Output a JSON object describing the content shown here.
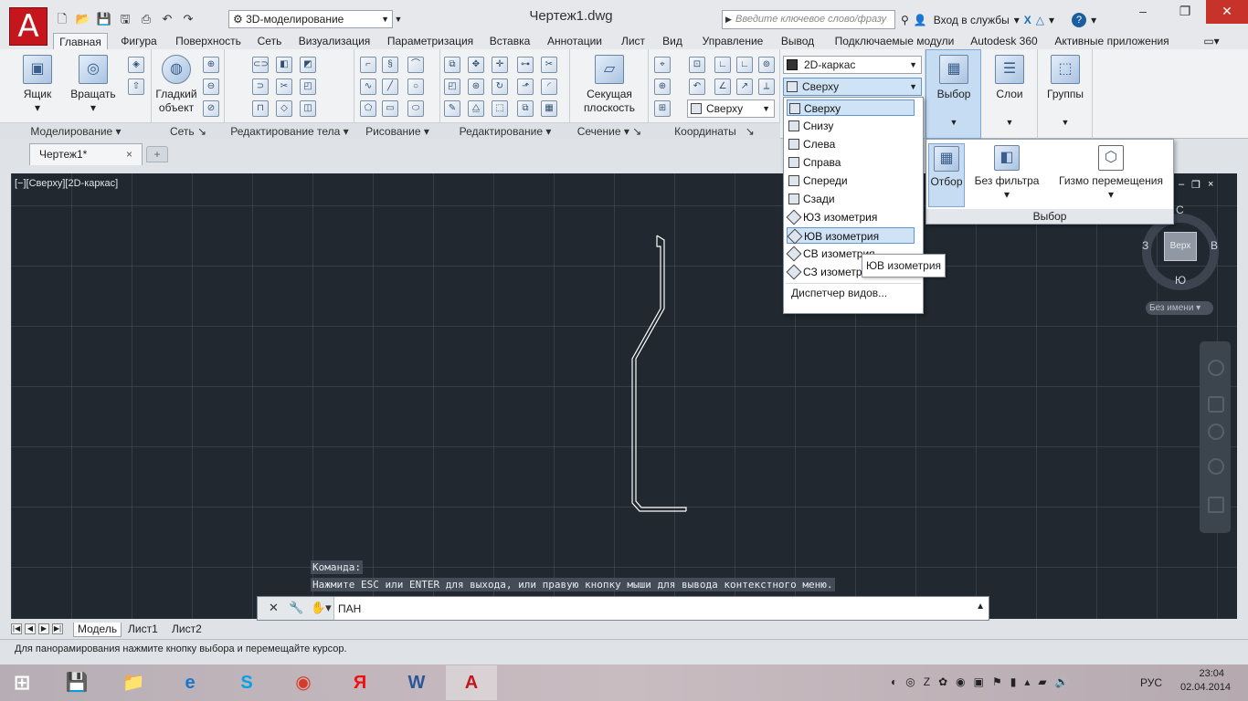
{
  "app": {
    "logo_letter": "A",
    "workspace": "3D-моделирование",
    "document_title": "Чертеж1.dwg",
    "search_placeholder": "Введите ключевое слово/фразу",
    "signin": "Вход в службы",
    "brand_color": "#c4161c"
  },
  "ribbon_tabs": [
    "Главная",
    "Фигура",
    "Поверхность",
    "Сеть",
    "Визуализация",
    "Параметризация",
    "Вставка",
    "Аннотации",
    "Лист",
    "Вид",
    "Управление",
    "Вывод",
    "Подключаемые модули",
    "Autodesk 360",
    "Активные приложения"
  ],
  "ribbon": {
    "modeling": {
      "title": "Моделирование",
      "box": "Ящик",
      "revolve": "Вращать"
    },
    "mesh": {
      "title": "Сеть",
      "smooth_line1": "Гладкий",
      "smooth_line2": "объект"
    },
    "solid_edit": {
      "title": "Редактирование тела"
    },
    "draw": {
      "title": "Рисование"
    },
    "modify": {
      "title": "Редактирование"
    },
    "section": {
      "title": "Сечение",
      "plane_line1": "Секущая",
      "plane_line2": "плоскость"
    },
    "coordinates": {
      "title": "Координаты",
      "view_combo": "Сверху"
    },
    "view": {
      "visual_style": "2D-каркас",
      "view_combo": "Сверху"
    },
    "selection": {
      "label": "Выбор"
    },
    "layers": {
      "label": "Слои"
    },
    "groups": {
      "label": "Группы"
    }
  },
  "file_tab": {
    "name": "Чертеж1*",
    "close": "×",
    "new": "+"
  },
  "viewport": {
    "label": "[−][Сверху][2D-каркас]",
    "controls": [
      "–",
      "❐",
      "×"
    ]
  },
  "viewcube": {
    "top": "С",
    "bottom": "Ю",
    "left": "З",
    "right": "В",
    "face": "Верх",
    "ucs_name": "Без имени"
  },
  "view_dropdown": {
    "items": [
      "Сверху",
      "Снизу",
      "Слева",
      "Справа",
      "Спереди",
      "Сзади",
      "ЮЗ изометрия",
      "ЮВ изометрия",
      "СВ изометрия",
      "СЗ изометрия"
    ],
    "selected_index": 0,
    "hover_index": 7,
    "manager": "Диспетчер видов..."
  },
  "tooltip": "ЮВ изометрия",
  "selection_popup": {
    "culling": "Отбор",
    "no_filter": "Без фильтра",
    "gizmo": "Гизмо перемещения",
    "footer": "Выбор"
  },
  "command": {
    "history": [
      "Команда:",
      "Нажмите ESC или ENTER для выхода, или правую кнопку мыши для вывода контекстного меню."
    ],
    "current": "ПАН"
  },
  "layout_tabs": [
    "Модель",
    "Лист1",
    "Лист2"
  ],
  "status_text": "Для панорамирования нажмите кнопку выбора и перемещайте курсор.",
  "taskbar": {
    "lang": "РУС",
    "time": "23:04",
    "date": "02.04.2014"
  }
}
